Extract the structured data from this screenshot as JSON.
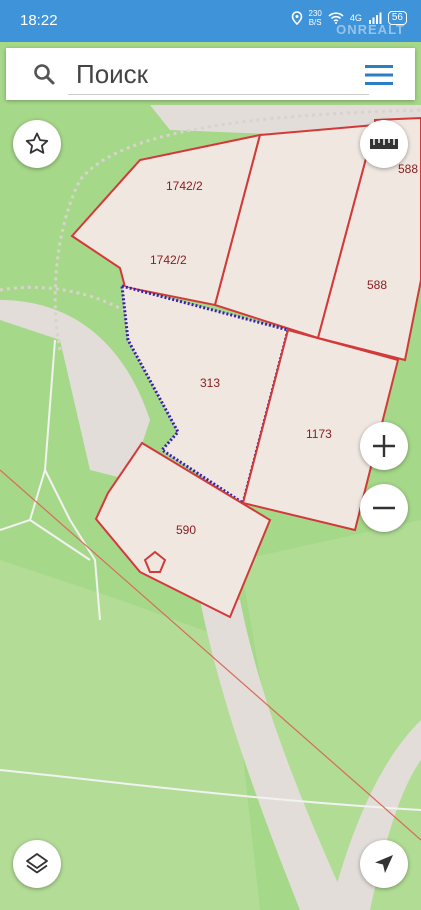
{
  "status_bar": {
    "time": "18:22",
    "net_rate_top": "230",
    "net_rate_bottom": "B/S",
    "network": "4G",
    "battery": "56"
  },
  "watermark": "ONREALT",
  "search": {
    "placeholder": "Поиск"
  },
  "icons": {
    "search": "search-icon",
    "menu": "hamburger-menu-icon",
    "favorite": "star-icon",
    "ruler": "ruler-icon",
    "zoom_in": "plus-icon",
    "zoom_out": "minus-icon",
    "layers": "layers-icon",
    "location": "navigation-arrow-icon"
  },
  "map": {
    "plots": [
      {
        "id": "p1742a",
        "label": "1742/2"
      },
      {
        "id": "p1742b",
        "label": "1742/2"
      },
      {
        "id": "p588a",
        "label": "588"
      },
      {
        "id": "p588b",
        "label": "588"
      },
      {
        "id": "p313",
        "label": "313"
      },
      {
        "id": "p1173",
        "label": "1173"
      },
      {
        "id": "p590",
        "label": "590"
      }
    ]
  },
  "colors": {
    "status_bar": "#3f93d9",
    "forest": "#a6d889",
    "parcel_fill": "#efe7e0",
    "parcel_border": "#d23a3a",
    "selected_border": "#3a1fb0",
    "road": "#e2ddd8"
  }
}
